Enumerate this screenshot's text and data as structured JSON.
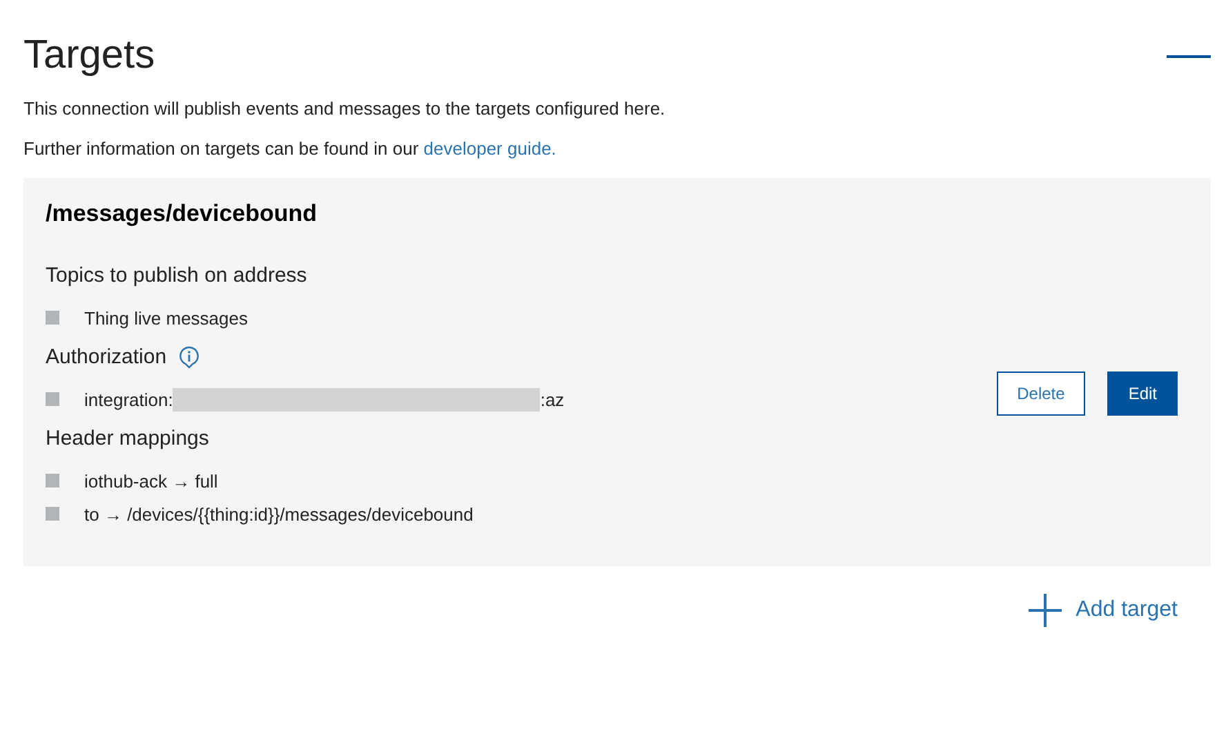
{
  "title": "Targets",
  "description": "This connection will publish events and messages to the targets configured here.",
  "info": {
    "text": "Further information on targets can be found in our ",
    "link": "developer guide."
  },
  "target": {
    "address": "/messages/devicebound",
    "sections": [
      {
        "kind": "plain",
        "heading": "Topics to publish on address",
        "info_icon": false,
        "items": [
          {
            "text": "Thing live messages"
          }
        ]
      },
      {
        "kind": "redacted",
        "heading": "Authorization",
        "info_icon": true,
        "items": [
          {
            "prefix": "integration:",
            "suffix": ":az"
          }
        ]
      },
      {
        "kind": "plain",
        "heading": "Header mappings",
        "info_icon": false,
        "items": [
          {
            "text": "iothub-ack → full"
          },
          {
            "text": "to → /devices/{{thing:id}}/messages/devicebound"
          }
        ]
      }
    ],
    "buttons": [
      {
        "label": "Delete",
        "kind": "secondary"
      },
      {
        "label": "Edit",
        "kind": "primary"
      }
    ]
  },
  "add_button": {
    "label": "Add target"
  }
}
